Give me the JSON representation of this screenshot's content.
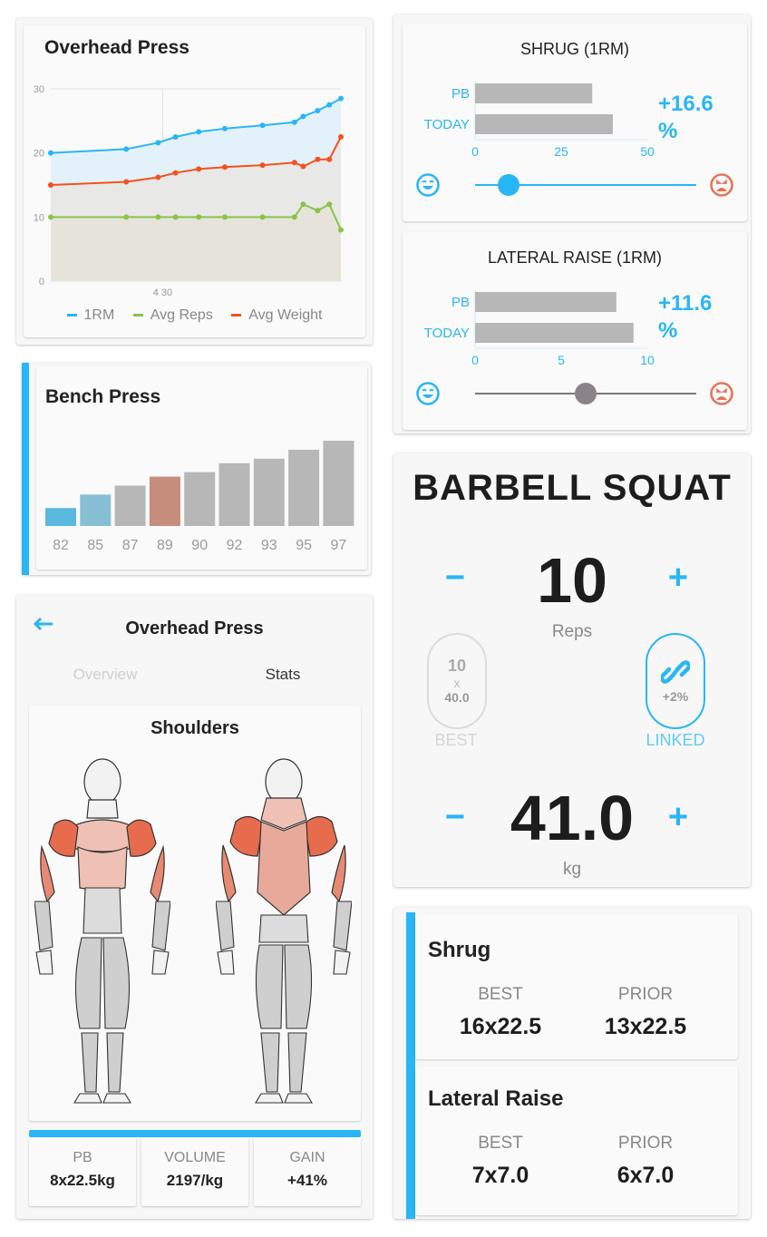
{
  "colors": {
    "accent": "#29b6f6",
    "orm_line": "#29b6f6",
    "reps_line": "#8bc34a",
    "weight_line": "#f4511e",
    "bar_gray": "#b7b7b7",
    "bar_blue_dark": "#5bb8de",
    "bar_blue_light": "#86bfd4",
    "bar_highlight": "#c68d7c",
    "happy_face": "#29b6f6",
    "sad_face": "#e57358"
  },
  "overhead_card": {
    "title": "Overhead Press",
    "legend": [
      "1RM",
      "Avg Reps",
      "Avg Weight"
    ]
  },
  "chart_data": [
    {
      "type": "line",
      "title": "Overhead Press",
      "x_tick_labels": [
        "4 30"
      ],
      "y_ticks": [
        "0",
        "10",
        "20",
        "30"
      ],
      "ylim": [
        0,
        30
      ],
      "grid": true,
      "legend_position": "bottom",
      "series": [
        {
          "name": "1RM",
          "values": [
            20,
            20.6,
            21.6,
            22.5,
            23.3,
            23.8,
            24.3,
            24.8,
            25.7,
            26.6,
            27.5,
            28.5
          ]
        },
        {
          "name": "Avg Reps",
          "values": [
            10,
            10,
            10,
            10,
            10,
            10,
            10,
            10,
            12,
            11,
            12,
            8
          ]
        },
        {
          "name": "Avg Weight",
          "values": [
            15,
            15.5,
            16.2,
            16.9,
            17.5,
            17.8,
            18.1,
            18.5,
            17.9,
            19,
            19,
            22.5
          ]
        }
      ]
    },
    {
      "type": "bar",
      "title": "Bench Press",
      "categories": [
        "82",
        "85",
        "87",
        "89",
        "90",
        "92",
        "93",
        "95",
        "97"
      ],
      "values": [
        82,
        85,
        87,
        89,
        90,
        92,
        93,
        95,
        97
      ],
      "ylim": [
        78,
        97
      ]
    },
    {
      "type": "bar",
      "orientation": "horizontal",
      "title": "SHRUG (1RM)",
      "categories": [
        "PB",
        "TODAY"
      ],
      "values": [
        34,
        40
      ],
      "x_ticks": [
        "0",
        "25",
        "50"
      ],
      "xlim": [
        0,
        50
      ]
    },
    {
      "type": "bar",
      "orientation": "horizontal",
      "title": "LATERAL RAISE (1RM)",
      "categories": [
        "PB",
        "TODAY"
      ],
      "values": [
        8.2,
        9.2
      ],
      "x_ticks": [
        "0",
        "5",
        "10"
      ],
      "xlim": [
        0,
        10
      ]
    }
  ],
  "bench_card": {
    "title": "Bench Press"
  },
  "muscle_card": {
    "back_icon": "arrow-left-icon",
    "title": "Overhead Press",
    "tabs": [
      "Overview",
      "Stats"
    ],
    "active_tab": "Stats",
    "section_title": "Shoulders",
    "stats": [
      {
        "label": "PB",
        "value": "8x22.5kg"
      },
      {
        "label": "VOLUME",
        "value": "2197/kg"
      },
      {
        "label": "GAIN",
        "value": "+41%"
      }
    ]
  },
  "shrug_rm": {
    "title": "SHRUG (1RM)",
    "pb_label": "PB",
    "today_label": "TODAY",
    "pct": "+16.6",
    "pct_sign": "%",
    "slider_level": 0.15
  },
  "lateral_rm": {
    "title": "LATERAL RAISE (1RM)",
    "pb_label": "PB",
    "today_label": "TODAY",
    "pct": "+11.6",
    "pct_sign": "%",
    "slider_level": 0.5
  },
  "squat_card": {
    "title": "BARBELL SQUAT",
    "reps": "10",
    "reps_label": "Reps",
    "weight": "41.0",
    "weight_label": "kg",
    "minus": "−",
    "plus": "+",
    "best": {
      "reps": "10",
      "x": "x",
      "weight": "40.0",
      "label": "BEST"
    },
    "linked": {
      "icon": "link-icon",
      "value": "+2%",
      "label": "LINKED"
    }
  },
  "history_cards": [
    {
      "name": "Shrug",
      "best_label": "BEST",
      "prior_label": "PRIOR",
      "best": "16x22.5",
      "prior": "13x22.5"
    },
    {
      "name": "Lateral Raise",
      "best_label": "BEST",
      "prior_label": "PRIOR",
      "best": "7x7.0",
      "prior": "6x7.0"
    }
  ]
}
